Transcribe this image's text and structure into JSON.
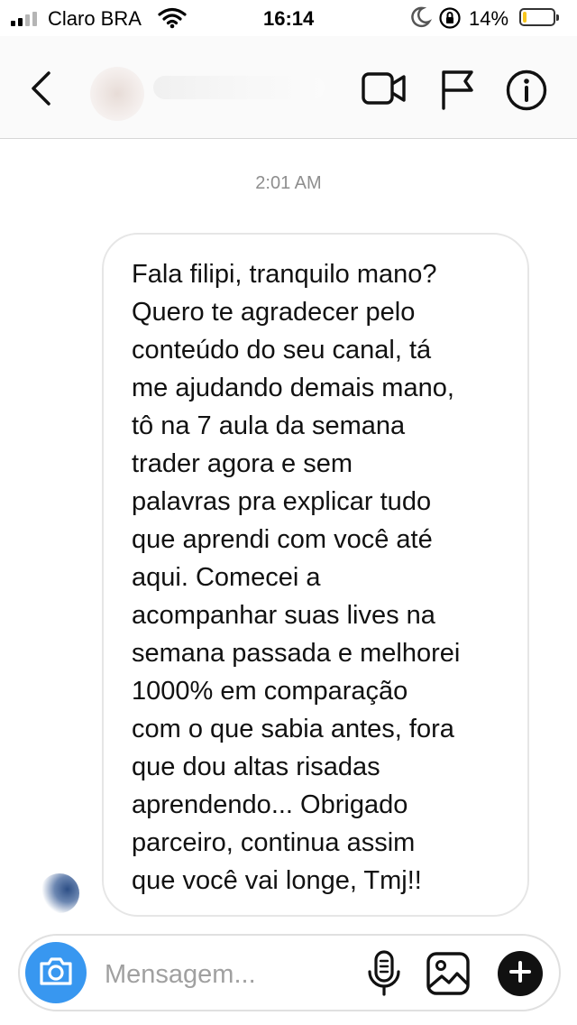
{
  "status_bar": {
    "carrier": "Claro BRA",
    "time": "16:14",
    "battery_percent": "14%",
    "battery_level": 0.14,
    "signal_bars_filled": 2,
    "signal_bars_total": 4,
    "icons": [
      "signal-icon",
      "wifi-icon",
      "moon-icon",
      "orientation-lock-icon",
      "battery-icon"
    ]
  },
  "header": {
    "icons": [
      "back-chevron-icon",
      "video-call-icon",
      "flag-icon",
      "info-icon"
    ]
  },
  "conversation": {
    "timestamp": "2:01 AM",
    "messages": [
      {
        "text": "Fala filipi, tranquilo mano?\nQuero te agradecer pelo\nconteúdo do seu canal, tá\nme ajudando demais mano,\ntô na 7 aula da semana\ntrader agora e sem\npalavras pra explicar tudo\nque aprendi com você até\naqui. Comecei a\nacompanhar suas lives na\nsemana passada e melhorei\n1000% em comparação\ncom o que sabia antes, fora\nque dou altas risadas\naprendendo... Obrigado\nparceiro, continua assim\nque você vai longe, Tmj!!"
      }
    ]
  },
  "composer": {
    "placeholder": "Mensagem...",
    "value": "",
    "icons": [
      "camera-icon",
      "microphone-icon",
      "gallery-icon",
      "plus-icon"
    ]
  },
  "colors": {
    "accent_blue": "#3897f0",
    "battery_yellow": "#f7c51d",
    "timestamp_gray": "#8e8e8e",
    "bubble_border": "#e6e6e6"
  }
}
